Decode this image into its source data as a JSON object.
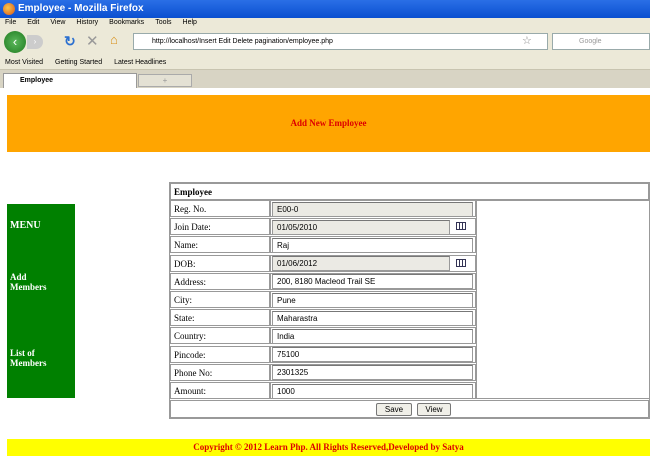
{
  "browser": {
    "title": "Employee - Mozilla Firefox",
    "menu": [
      "File",
      "Edit",
      "View",
      "History",
      "Bookmarks",
      "Tools",
      "Help"
    ],
    "url": "http://localhost/Insert Edit Delete pagination/employee.php",
    "search_placeholder": "Google",
    "bookmarks": [
      "Most Visited",
      "Getting Started",
      "Latest Headlines"
    ],
    "tab": "Employee",
    "new_tab": "+"
  },
  "banner": "Add New Employee",
  "sidebar": {
    "menu": "MENU",
    "add": "Add Members",
    "list": "List of Members"
  },
  "form": {
    "title": "Employee",
    "fields": [
      {
        "label": "Reg. No.",
        "value": "E00-0",
        "readonly": true
      },
      {
        "label": "Join Date:",
        "value": "01/05/2010",
        "readonly": true,
        "calendar": true
      },
      {
        "label": "Name:",
        "value": "Raj"
      },
      {
        "label": "DOB:",
        "value": "01/06/2012",
        "readonly": true,
        "calendar": true
      },
      {
        "label": "Address:",
        "value": "200, 8180 Macleod Trail SE"
      },
      {
        "label": "City:",
        "value": "Pune"
      },
      {
        "label": "State:",
        "value": "Maharastra"
      },
      {
        "label": "Country:",
        "value": "India"
      },
      {
        "label": "Pincode:",
        "value": "75100"
      },
      {
        "label": "Phone No:",
        "value": "2301325"
      },
      {
        "label": "Amount:",
        "value": "1000"
      }
    ],
    "save": "Save",
    "view": "View"
  },
  "footer": "Copyright © 2012 Learn Php. All Rights Reserved,Developed by Satya",
  "colors": {
    "banner": "#ffa500",
    "sidebar": "#008000",
    "footer": "#ffff00",
    "accent_text": "#dd0000"
  }
}
